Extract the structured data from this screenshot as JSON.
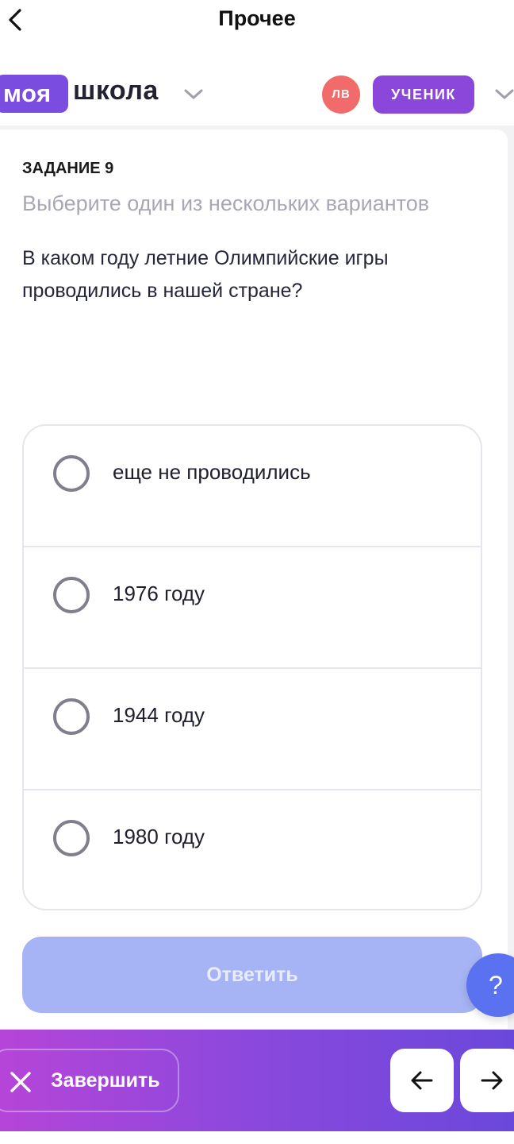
{
  "topbar": {
    "title": "Прочее",
    "back_icon": "chevron-left-icon"
  },
  "header": {
    "logo_part1": "моя",
    "logo_part2": "школа",
    "avatar_initials": "ЛВ",
    "role": "УЧЕНИК",
    "colors": {
      "logo": "#7b4ce0",
      "avatar": "#f26b6b",
      "role": "#8a47d9"
    }
  },
  "task": {
    "label": "ЗАДАНИЕ 9",
    "hint": "Выберите один из нескольких вариантов",
    "question": "В каком году летние Олимпийские игры проводились в нашей стране?",
    "options": [
      {
        "label": "еще не проводились",
        "selected": false
      },
      {
        "label": "1976 году",
        "selected": false
      },
      {
        "label": "1944 году",
        "selected": false
      },
      {
        "label": "1980 году",
        "selected": false
      }
    ],
    "answer_button": "Ответить",
    "answer_button_color": "#a6b4f5"
  },
  "help": {
    "label": "?"
  },
  "bottombar": {
    "finish_label": "Завершить",
    "finish_icon": "close-icon",
    "prev_icon": "arrow-left-icon",
    "next_icon": "arrow-right-icon"
  }
}
